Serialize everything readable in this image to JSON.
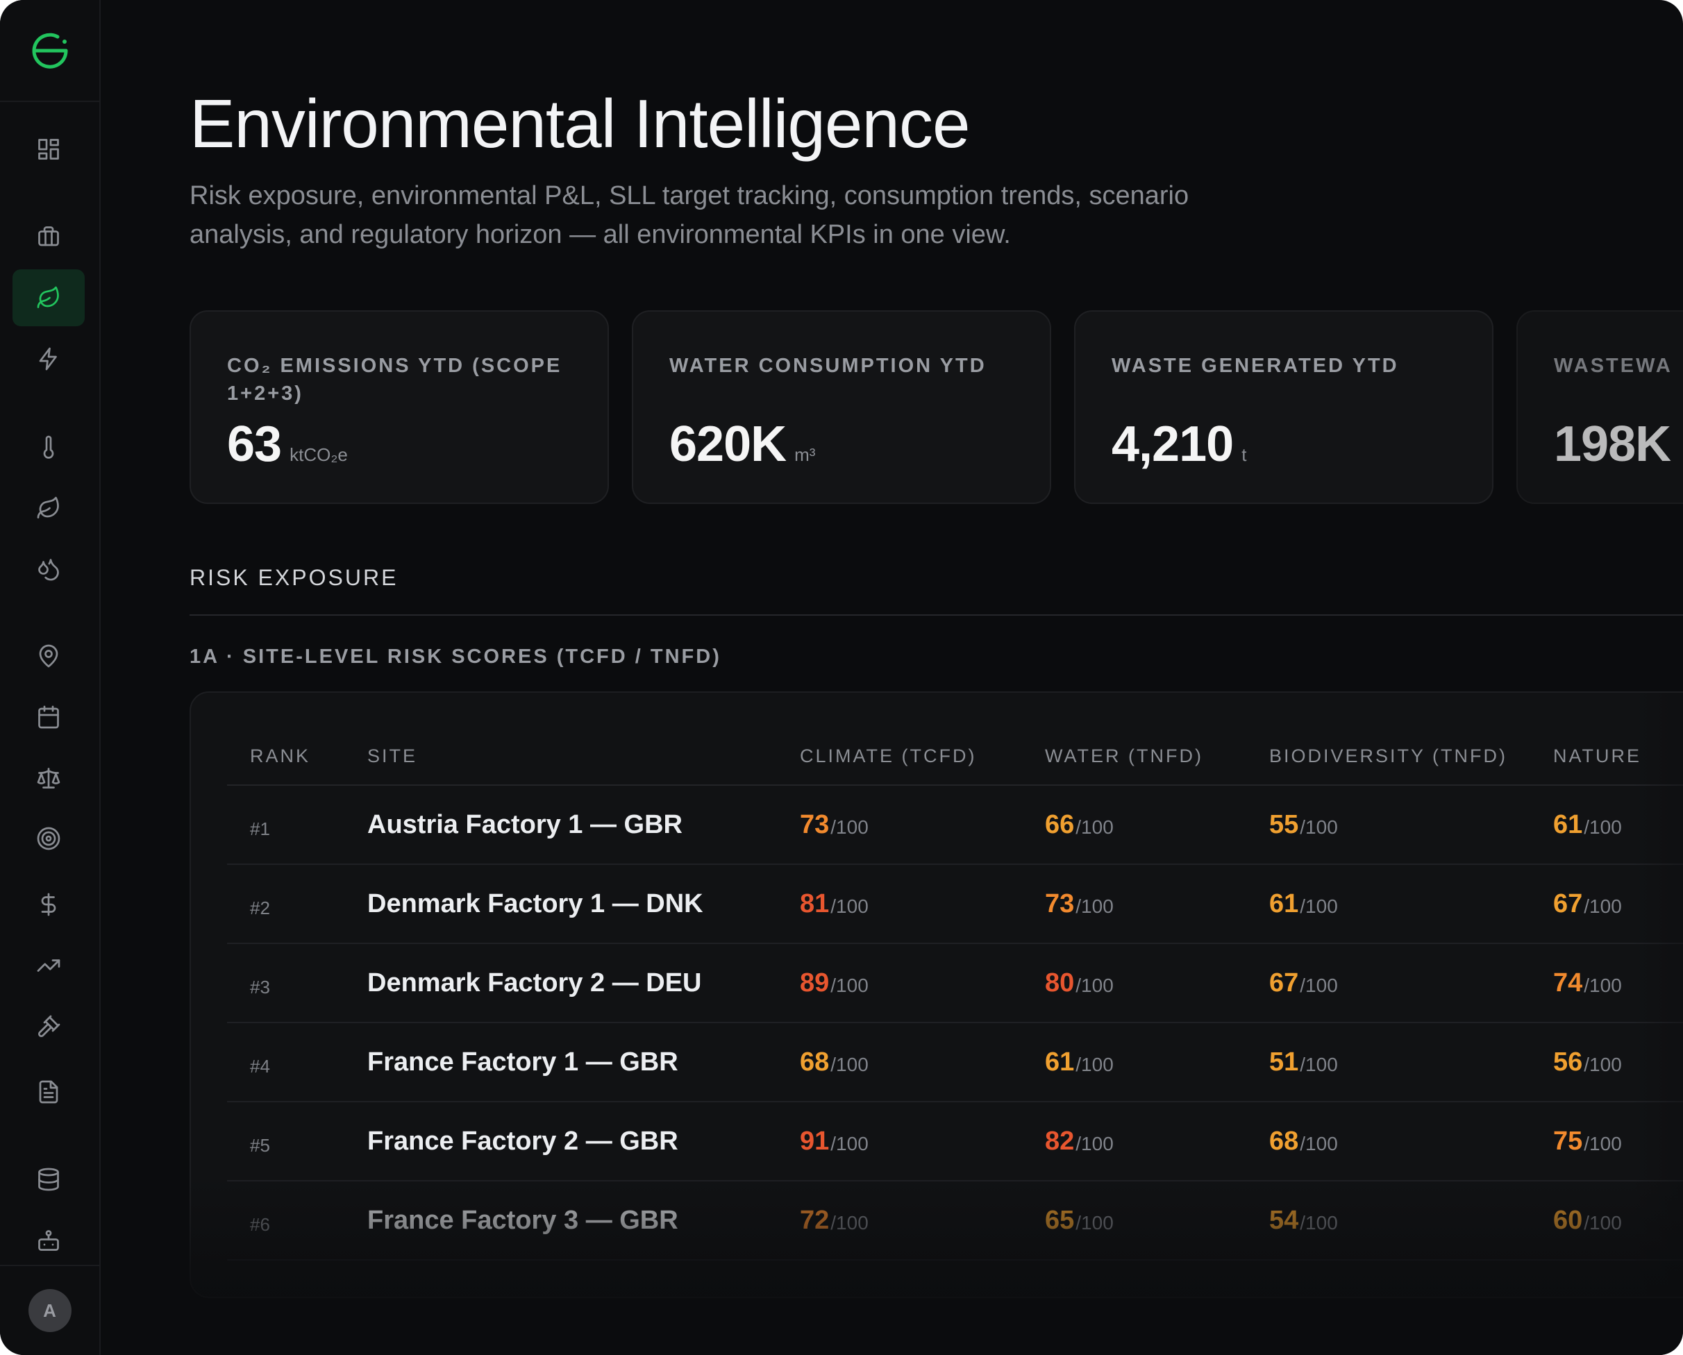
{
  "header": {
    "title": "Environmental Intelligence",
    "subtitle": "Risk exposure, environmental P&L, SLL target tracking, consumption trends, scenario analysis, and regulatory horizon — all environmental KPIs in one view."
  },
  "user": {
    "avatar_initial": "A"
  },
  "sidebar": {
    "items": [
      {
        "icon": "dashboard-grid-icon",
        "active": false
      },
      {
        "icon": "briefcase-icon",
        "active": false
      },
      {
        "icon": "leaf-icon",
        "active": true
      },
      {
        "icon": "lightning-icon",
        "active": false
      },
      {
        "icon": "thermometer-icon",
        "active": false
      },
      {
        "icon": "leaf-icon",
        "active": false
      },
      {
        "icon": "droplets-icon",
        "active": false
      },
      {
        "icon": "map-pin-icon",
        "active": false
      },
      {
        "icon": "calendar-icon",
        "active": false
      },
      {
        "icon": "scale-icon",
        "active": false
      },
      {
        "icon": "target-icon",
        "active": false
      },
      {
        "icon": "dollar-icon",
        "active": false
      },
      {
        "icon": "trending-up-icon",
        "active": false
      },
      {
        "icon": "gavel-icon",
        "active": false
      },
      {
        "icon": "document-icon",
        "active": false
      },
      {
        "icon": "database-icon",
        "active": false
      },
      {
        "icon": "robot-icon",
        "active": false
      }
    ]
  },
  "kpis": [
    {
      "label": "CO₂ EMISSIONS YTD (SCOPE 1+2+3)",
      "value": "63",
      "unit": "ktCO₂e"
    },
    {
      "label": "WATER CONSUMPTION YTD",
      "value": "620K",
      "unit": "m³"
    },
    {
      "label": "WASTE GENERATED YTD",
      "value": "4,210",
      "unit": "t"
    },
    {
      "label": "WASTEWA",
      "value": "198K",
      "unit": ""
    }
  ],
  "risk": {
    "section_title": "RISK EXPOSURE",
    "subsection_title": "1A · SITE-LEVEL RISK SCORES (TCFD / TNFD)",
    "columns": {
      "rank": "RANK",
      "site": "SITE",
      "climate": "CLIMATE (TCFD)",
      "water": "WATER (TNFD)",
      "biodiversity": "BIODIVERSITY (TNFD)",
      "nature": "NATURE"
    },
    "out_of": "/100",
    "rows": [
      {
        "rank": "#1",
        "site": "Austria Factory 1 — GBR",
        "climate": "73",
        "water": "66",
        "biodiversity": "55",
        "nature": "61"
      },
      {
        "rank": "#2",
        "site": "Denmark Factory 1 — DNK",
        "climate": "81",
        "water": "73",
        "biodiversity": "61",
        "nature": "67"
      },
      {
        "rank": "#3",
        "site": "Denmark Factory 2 — DEU",
        "climate": "89",
        "water": "80",
        "biodiversity": "67",
        "nature": "74"
      },
      {
        "rank": "#4",
        "site": "France Factory 1 — GBR",
        "climate": "68",
        "water": "61",
        "biodiversity": "51",
        "nature": "56"
      },
      {
        "rank": "#5",
        "site": "France Factory 2 — GBR",
        "climate": "91",
        "water": "82",
        "biodiversity": "68",
        "nature": "75"
      },
      {
        "rank": "#6",
        "site": "France Factory 3 — GBR",
        "climate": "72",
        "water": "65",
        "biodiversity": "54",
        "nature": "60"
      }
    ]
  },
  "colors": {
    "accent_green": "#22c55e",
    "score_high": "#e8562f",
    "score_elevated": "#f28a2e",
    "score_medium": "#f0a030"
  }
}
